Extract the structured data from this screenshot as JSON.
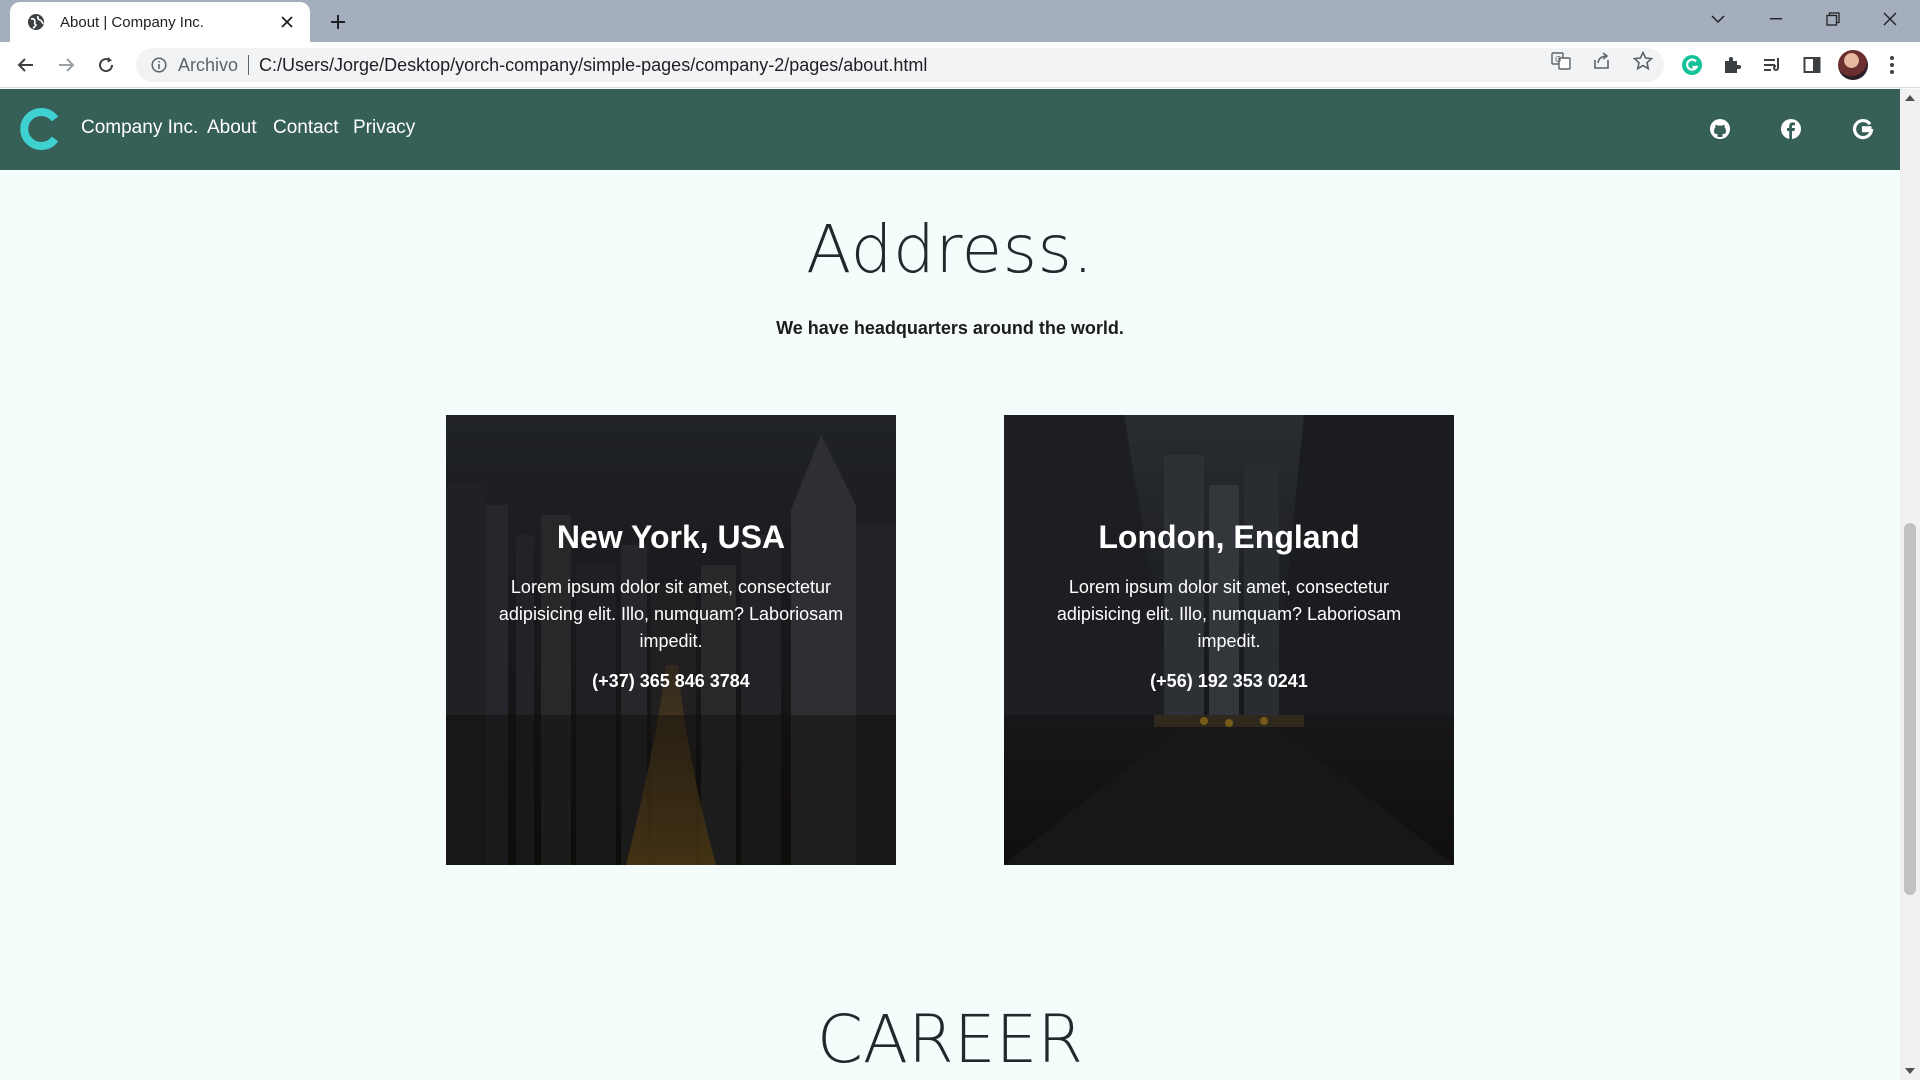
{
  "browser": {
    "tab_title": "About | Company Inc.",
    "omnibox_scheme": "Archivo",
    "url": "C:/Users/Jorge/Desktop/yorch-company/simple-pages/company-2/pages/about.html"
  },
  "site_nav": {
    "brand": "Company Inc.",
    "links": [
      "About",
      "Contact",
      "Privacy"
    ],
    "bg_color": "#365f58",
    "logo_color": "#3fd1cf",
    "social_icons": [
      "github-icon",
      "facebook-icon",
      "google-icon"
    ]
  },
  "address": {
    "title": "Address.",
    "subtitle": "We have headquarters around the world.",
    "offices": [
      {
        "city": "New York, USA",
        "description": "Lorem ipsum dolor sit amet, consectetur adipisicing elit. Illo, numquam? Laboriosam impedit.",
        "phone": "(+37) 365 846 3784"
      },
      {
        "city": "London, England",
        "description": "Lorem ipsum dolor sit amet, consectetur adipisicing elit. Illo, numquam? Laboriosam impedit.",
        "phone": "(+56) 192 353 0241"
      }
    ]
  },
  "career": {
    "title": "CAREER"
  }
}
